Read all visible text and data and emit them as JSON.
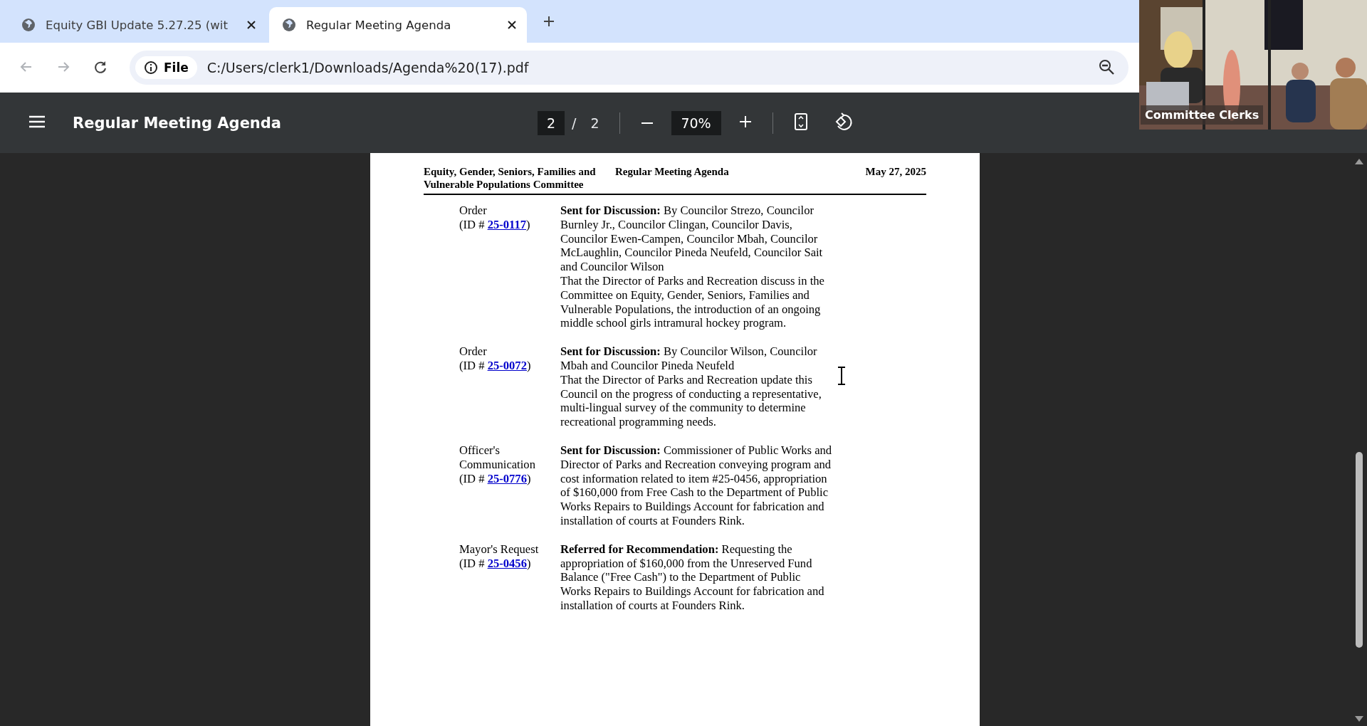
{
  "browser": {
    "tabs": [
      {
        "title": "Equity GBI Update 5.27.25 (wit",
        "selected": false
      },
      {
        "title": "Regular Meeting Agenda",
        "selected": true
      }
    ],
    "nav": [
      {
        "kind": "back",
        "disabled": true
      },
      {
        "kind": "forward",
        "disabled": true
      },
      {
        "kind": "reload",
        "disabled": false
      }
    ],
    "address": {
      "chip": "File",
      "url": "C:/Users/clerk1/Downloads/Agenda%20(17).pdf"
    }
  },
  "viewer": {
    "title": "Regular Meeting Agenda",
    "page": "2",
    "separator": "/",
    "page_count": "2",
    "zoom": "70%"
  },
  "document": {
    "header": {
      "committee": "Equity, Gender, Seniors, Families and Vulnerable Populations Committee",
      "title": "Regular Meeting Agenda",
      "date": "May 27, 2025"
    },
    "items": [
      {
        "type": "Order",
        "ref_prefix": "(ID #",
        "ref_id": "25-0117",
        "ref_suffix": ")",
        "paragraphs": [
          "**Sent for Discussion:** By Councilor Strezo, Councilor Burnley Jr., Councilor Clingan, Councilor Davis, Councilor Ewen-Campen, Councilor Mbah, Councilor McLaughlin, Councilor Pineda Neufeld, Councilor Sait and Councilor Wilson",
          "That the Director of Parks and Recreation discuss in the Committee on Equity, Gender, Seniors, Families and Vulnerable Populations, the introduction of an ongoing middle school girls intramural hockey program."
        ]
      },
      {
        "type": "Order",
        "ref_prefix": "(ID #",
        "ref_id": "25-0072",
        "ref_suffix": ")",
        "paragraphs": [
          "**Sent for Discussion:** By Councilor Wilson, Councilor Mbah and Councilor Pineda Neufeld",
          "That the Director of Parks and Recreation update this Council on the progress of conducting a representative, multi-lingual survey of the community to determine recreational programming needs."
        ]
      },
      {
        "type": "Officer's Communication",
        "ref_prefix": "(ID #",
        "ref_id": "25-0776",
        "ref_suffix": ")",
        "paragraphs": [
          "**Sent for Discussion:** Commissioner of Public Works and Director of Parks and Recreation conveying program and cost information related to item #25-0456, appropriation of $160,000 from Free Cash to the Department of Public Works Repairs to Buildings Account for fabrication and installation of courts at Founders Rink."
        ]
      },
      {
        "type": "Mayor's Request",
        "ref_prefix": "(ID #",
        "ref_id": "25-0456",
        "ref_suffix": ")",
        "paragraphs": [
          "**Referred for Recommendation:** Requesting the appropriation of $160,000 from the Unreserved Fund Balance (\"Free Cash\") to the Department of Public Works Repairs to Buildings Account for fabrication and installation of courts at Founders Rink."
        ]
      }
    ]
  },
  "video_overlay": {
    "kind": "picture",
    "label": "Committee Clerks"
  }
}
